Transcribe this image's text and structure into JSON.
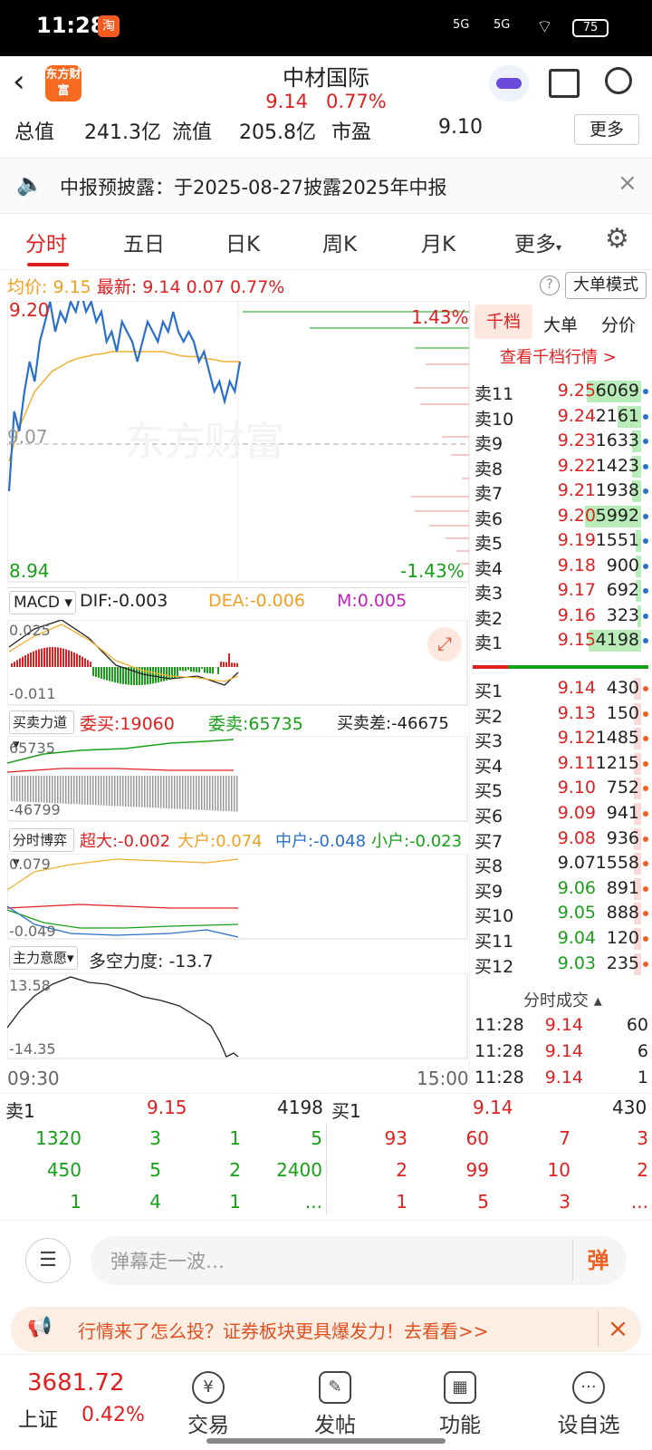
{
  "status_bar": {
    "time": "11:28",
    "app_badge": "淘",
    "signal1": "5G",
    "signal2": "5G",
    "battery": "75"
  },
  "header": {
    "title": "中材国际",
    "price": "9.14",
    "change_pct": "0.77%",
    "logo_text": "东方财富"
  },
  "info_row": {
    "total_cap_label": "总值",
    "total_cap": "241.3亿",
    "float_cap_label": "流值",
    "float_cap": "205.8亿",
    "pe_label": "市盈",
    "pe": "9.10",
    "more": "更多"
  },
  "notice": {
    "text": "中报预披露：于2025-08-27披露2025年中报"
  },
  "tabs": [
    "分时",
    "五日",
    "日K",
    "周K",
    "月K",
    "更多"
  ],
  "legend": {
    "avg_label": "均价:",
    "avg": "9.15",
    "last_label": "最新:",
    "last": "9.14",
    "chg": "0.07",
    "pct": "0.77%",
    "big_order": "大单模式"
  },
  "chart": {
    "price_high": "9.20",
    "price_mid": "9.07",
    "price_low": "8.94",
    "pct_high": "1.43%",
    "pct_low": "-1.43%",
    "watermark": "东方财富",
    "time_start": "09:30",
    "time_end": "15:00",
    "price_series": [
      9.02,
      9.1,
      9.08,
      9.12,
      9.15,
      9.13,
      9.17,
      9.19,
      9.21,
      9.18,
      9.2,
      9.19,
      9.21,
      9.2,
      9.22,
      9.2,
      9.21,
      9.19,
      9.2,
      9.17,
      9.18,
      9.16,
      9.19,
      9.18,
      9.17,
      9.15,
      9.17,
      9.19,
      9.18,
      9.17,
      9.19,
      9.18,
      9.2,
      9.18,
      9.17,
      9.18,
      9.17,
      9.15,
      9.16,
      9.14,
      9.12,
      9.13,
      9.11,
      9.13,
      9.12,
      9.15
    ],
    "avg_series": [
      9.05,
      9.08,
      9.1,
      9.12,
      9.13,
      9.14,
      9.145,
      9.15,
      9.153,
      9.155,
      9.157,
      9.158,
      9.16,
      9.16,
      9.16,
      9.16,
      9.16,
      9.16,
      9.16,
      9.158,
      9.156,
      9.155,
      9.155,
      9.153,
      9.152,
      9.15,
      9.15,
      9.15
    ]
  },
  "macd": {
    "label": "MACD",
    "dif": "DIF:-0.003",
    "dea": "DEA:-0.006",
    "m": "M:0.005",
    "top": "0.025",
    "bottom": "-0.011"
  },
  "flow": {
    "label": "买卖力道",
    "buy": "委买:19060",
    "sell": "委卖:65735",
    "diff": "买卖差:-46675",
    "top": "65735",
    "bottom": "-46799"
  },
  "game": {
    "label": "分时博弈",
    "xl": "超大:-0.002",
    "big": "大户:0.074",
    "mid": "中户:-0.048",
    "small": "小户:-0.023",
    "top": "0.079",
    "bottom": "-0.049"
  },
  "main_force": {
    "label": "主力意愿",
    "value": "多空力度: -13.7",
    "top": "13.58",
    "bottom": "-14.35"
  },
  "order_book": {
    "tabs": [
      "千档",
      "大单",
      "分价"
    ],
    "link": "查看千档行情 >",
    "sells": [
      {
        "label": "卖11",
        "price": "9.25",
        "vol": "6069",
        "bar": 60
      },
      {
        "label": "卖10",
        "price": "9.24",
        "vol": "2161",
        "bar": 26
      },
      {
        "label": "卖9",
        "price": "9.23",
        "vol": "1633",
        "bar": 10
      },
      {
        "label": "卖8",
        "price": "9.22",
        "vol": "1423",
        "bar": 10
      },
      {
        "label": "卖7",
        "price": "9.21",
        "vol": "1938",
        "bar": 10
      },
      {
        "label": "卖6",
        "price": "9.20",
        "vol": "5992",
        "bar": 62
      },
      {
        "label": "卖5",
        "price": "9.19",
        "vol": "1551",
        "bar": 6
      },
      {
        "label": "卖4",
        "price": "9.18",
        "vol": "900",
        "bar": 6
      },
      {
        "label": "卖3",
        "price": "9.17",
        "vol": "692",
        "bar": 6
      },
      {
        "label": "卖2",
        "price": "9.16",
        "vol": "323",
        "bar": 4
      },
      {
        "label": "卖1",
        "price": "9.15",
        "vol": "4198",
        "bar": 58
      }
    ],
    "buys": [
      {
        "label": "买1",
        "price": "9.14",
        "vol": "430",
        "color": "red"
      },
      {
        "label": "买2",
        "price": "9.13",
        "vol": "150",
        "color": "red"
      },
      {
        "label": "买3",
        "price": "9.12",
        "vol": "1485",
        "color": "red"
      },
      {
        "label": "买4",
        "price": "9.11",
        "vol": "1215",
        "color": "red"
      },
      {
        "label": "买5",
        "price": "9.10",
        "vol": "752",
        "color": "red"
      },
      {
        "label": "买6",
        "price": "9.09",
        "vol": "941",
        "color": "red"
      },
      {
        "label": "买7",
        "price": "9.08",
        "vol": "936",
        "color": "red"
      },
      {
        "label": "买8",
        "price": "9.07",
        "vol": "1558",
        "color": "black"
      },
      {
        "label": "买9",
        "price": "9.06",
        "vol": "891",
        "color": "green"
      },
      {
        "label": "买10",
        "price": "9.05",
        "vol": "888",
        "color": "green"
      },
      {
        "label": "买11",
        "price": "9.04",
        "vol": "120",
        "color": "green"
      },
      {
        "label": "买12",
        "price": "9.03",
        "vol": "235",
        "color": "green"
      }
    ],
    "trades_title": "分时成交",
    "trades": [
      {
        "time": "11:28",
        "price": "9.14",
        "vol": "60"
      },
      {
        "time": "11:28",
        "price": "9.14",
        "vol": "6"
      },
      {
        "time": "11:28",
        "price": "9.14",
        "vol": "1"
      }
    ]
  },
  "queue": {
    "sell_label": "卖1",
    "sell_price": "9.15",
    "sell_vol": "4198",
    "buy_label": "买1",
    "buy_price": "9.14",
    "buy_vol": "430",
    "sell_rows": [
      [
        "1320",
        "3",
        "1",
        "5"
      ],
      [
        "450",
        "5",
        "2",
        "2400"
      ],
      [
        "1",
        "4",
        "1",
        "..."
      ]
    ],
    "buy_rows": [
      [
        "93",
        "60",
        "7",
        "3"
      ],
      [
        "2",
        "99",
        "10",
        "2"
      ],
      [
        "1",
        "5",
        "3",
        "..."
      ]
    ]
  },
  "danmaku": {
    "placeholder": "弹幕走一波…",
    "btn": "弹"
  },
  "banner": {
    "text": "行情来了怎么投？证券板块更具爆发力！去看看>>"
  },
  "bottom_nav": {
    "index_value": "3681.72",
    "index_name": "上证",
    "index_pct": "0.42%",
    "items": [
      "交易",
      "发帖",
      "功能",
      "设自选"
    ]
  }
}
